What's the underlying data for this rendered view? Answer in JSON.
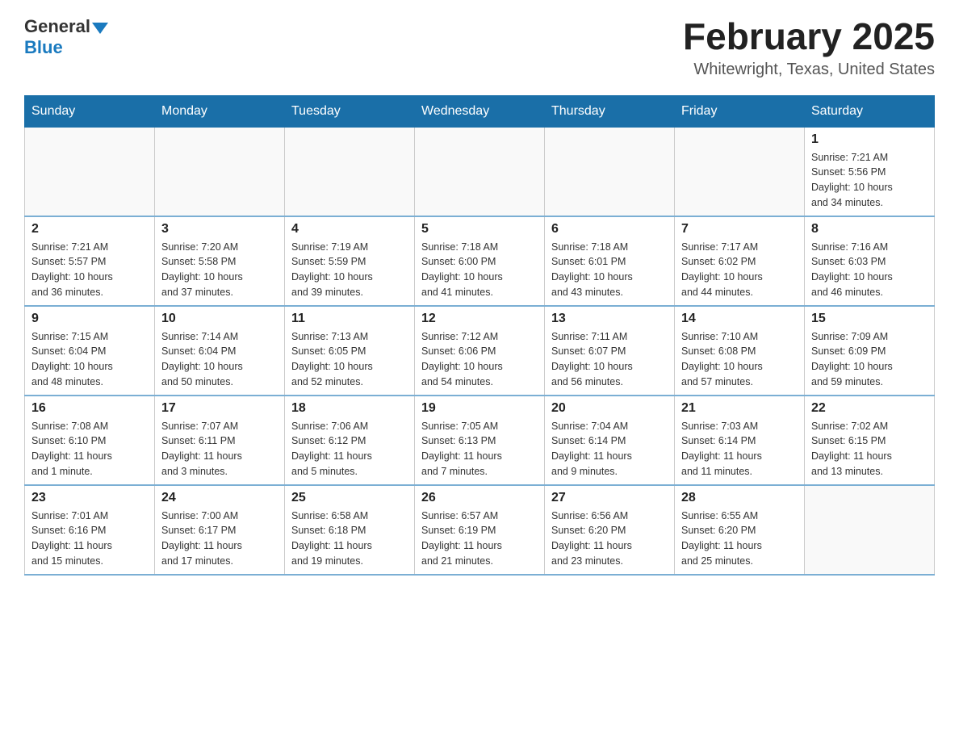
{
  "logo": {
    "general": "General",
    "blue": "Blue",
    "arrow": "▼"
  },
  "title": "February 2025",
  "subtitle": "Whitewright, Texas, United States",
  "weekdays": [
    "Sunday",
    "Monday",
    "Tuesday",
    "Wednesday",
    "Thursday",
    "Friday",
    "Saturday"
  ],
  "weeks": [
    [
      {
        "day": "",
        "info": ""
      },
      {
        "day": "",
        "info": ""
      },
      {
        "day": "",
        "info": ""
      },
      {
        "day": "",
        "info": ""
      },
      {
        "day": "",
        "info": ""
      },
      {
        "day": "",
        "info": ""
      },
      {
        "day": "1",
        "info": "Sunrise: 7:21 AM\nSunset: 5:56 PM\nDaylight: 10 hours\nand 34 minutes."
      }
    ],
    [
      {
        "day": "2",
        "info": "Sunrise: 7:21 AM\nSunset: 5:57 PM\nDaylight: 10 hours\nand 36 minutes."
      },
      {
        "day": "3",
        "info": "Sunrise: 7:20 AM\nSunset: 5:58 PM\nDaylight: 10 hours\nand 37 minutes."
      },
      {
        "day": "4",
        "info": "Sunrise: 7:19 AM\nSunset: 5:59 PM\nDaylight: 10 hours\nand 39 minutes."
      },
      {
        "day": "5",
        "info": "Sunrise: 7:18 AM\nSunset: 6:00 PM\nDaylight: 10 hours\nand 41 minutes."
      },
      {
        "day": "6",
        "info": "Sunrise: 7:18 AM\nSunset: 6:01 PM\nDaylight: 10 hours\nand 43 minutes."
      },
      {
        "day": "7",
        "info": "Sunrise: 7:17 AM\nSunset: 6:02 PM\nDaylight: 10 hours\nand 44 minutes."
      },
      {
        "day": "8",
        "info": "Sunrise: 7:16 AM\nSunset: 6:03 PM\nDaylight: 10 hours\nand 46 minutes."
      }
    ],
    [
      {
        "day": "9",
        "info": "Sunrise: 7:15 AM\nSunset: 6:04 PM\nDaylight: 10 hours\nand 48 minutes."
      },
      {
        "day": "10",
        "info": "Sunrise: 7:14 AM\nSunset: 6:04 PM\nDaylight: 10 hours\nand 50 minutes."
      },
      {
        "day": "11",
        "info": "Sunrise: 7:13 AM\nSunset: 6:05 PM\nDaylight: 10 hours\nand 52 minutes."
      },
      {
        "day": "12",
        "info": "Sunrise: 7:12 AM\nSunset: 6:06 PM\nDaylight: 10 hours\nand 54 minutes."
      },
      {
        "day": "13",
        "info": "Sunrise: 7:11 AM\nSunset: 6:07 PM\nDaylight: 10 hours\nand 56 minutes."
      },
      {
        "day": "14",
        "info": "Sunrise: 7:10 AM\nSunset: 6:08 PM\nDaylight: 10 hours\nand 57 minutes."
      },
      {
        "day": "15",
        "info": "Sunrise: 7:09 AM\nSunset: 6:09 PM\nDaylight: 10 hours\nand 59 minutes."
      }
    ],
    [
      {
        "day": "16",
        "info": "Sunrise: 7:08 AM\nSunset: 6:10 PM\nDaylight: 11 hours\nand 1 minute."
      },
      {
        "day": "17",
        "info": "Sunrise: 7:07 AM\nSunset: 6:11 PM\nDaylight: 11 hours\nand 3 minutes."
      },
      {
        "day": "18",
        "info": "Sunrise: 7:06 AM\nSunset: 6:12 PM\nDaylight: 11 hours\nand 5 minutes."
      },
      {
        "day": "19",
        "info": "Sunrise: 7:05 AM\nSunset: 6:13 PM\nDaylight: 11 hours\nand 7 minutes."
      },
      {
        "day": "20",
        "info": "Sunrise: 7:04 AM\nSunset: 6:14 PM\nDaylight: 11 hours\nand 9 minutes."
      },
      {
        "day": "21",
        "info": "Sunrise: 7:03 AM\nSunset: 6:14 PM\nDaylight: 11 hours\nand 11 minutes."
      },
      {
        "day": "22",
        "info": "Sunrise: 7:02 AM\nSunset: 6:15 PM\nDaylight: 11 hours\nand 13 minutes."
      }
    ],
    [
      {
        "day": "23",
        "info": "Sunrise: 7:01 AM\nSunset: 6:16 PM\nDaylight: 11 hours\nand 15 minutes."
      },
      {
        "day": "24",
        "info": "Sunrise: 7:00 AM\nSunset: 6:17 PM\nDaylight: 11 hours\nand 17 minutes."
      },
      {
        "day": "25",
        "info": "Sunrise: 6:58 AM\nSunset: 6:18 PM\nDaylight: 11 hours\nand 19 minutes."
      },
      {
        "day": "26",
        "info": "Sunrise: 6:57 AM\nSunset: 6:19 PM\nDaylight: 11 hours\nand 21 minutes."
      },
      {
        "day": "27",
        "info": "Sunrise: 6:56 AM\nSunset: 6:20 PM\nDaylight: 11 hours\nand 23 minutes."
      },
      {
        "day": "28",
        "info": "Sunrise: 6:55 AM\nSunset: 6:20 PM\nDaylight: 11 hours\nand 25 minutes."
      },
      {
        "day": "",
        "info": ""
      }
    ]
  ]
}
